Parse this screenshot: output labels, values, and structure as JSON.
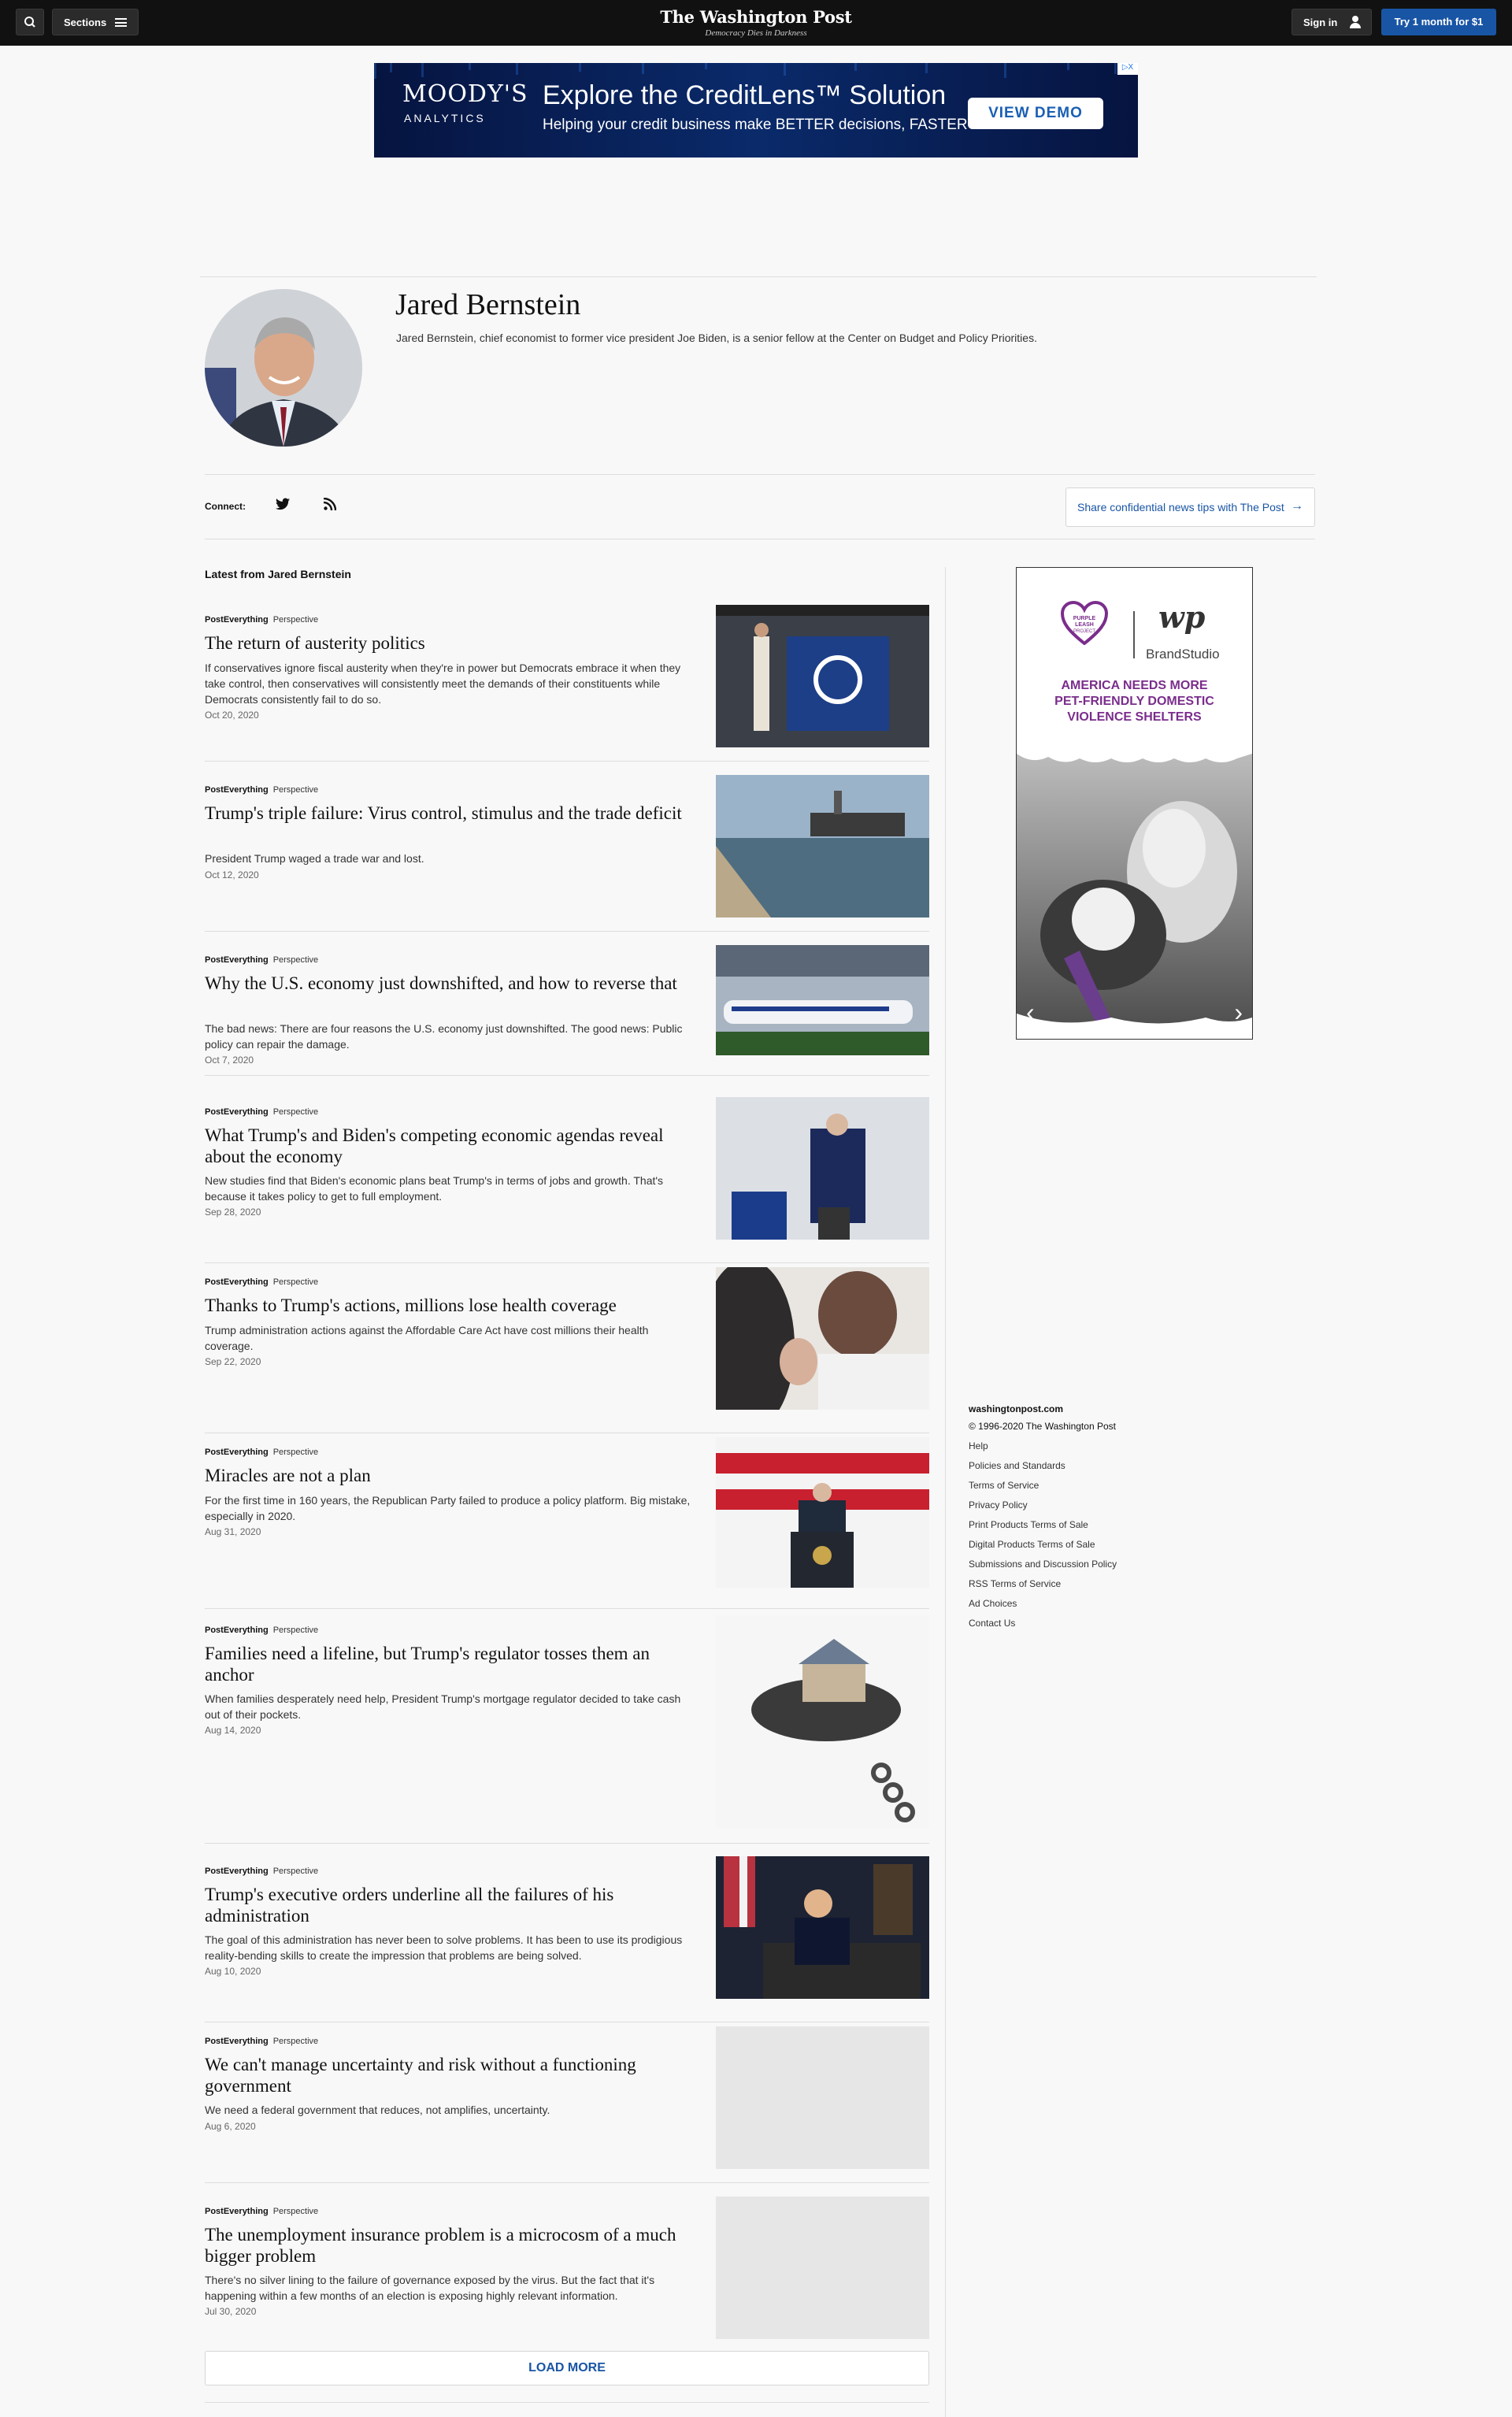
{
  "nav": {
    "search_icon": "search-icon",
    "sections_label": "Sections",
    "logo": "The Washington Post",
    "tagline": "Democracy Dies in Darkness",
    "signin_label": "Sign in",
    "subscribe_label": "Try 1 month for $1"
  },
  "banner_ad": {
    "brand": "MOODY'S",
    "brand_sub": "ANALYTICS",
    "headline": "Explore the CreditLens™ Solution",
    "subline": "Helping your credit business make BETTER decisions, FASTER",
    "cta": "VIEW DEMO",
    "close": "▷X"
  },
  "author": {
    "name": "Jared Bernstein",
    "bio": "Jared Bernstein, chief economist to former vice president Joe Biden, is a senior fellow at the Center on Budget and Policy Priorities."
  },
  "connect": {
    "label": "Connect:",
    "tips_label": "Share confidential news tips with The Post",
    "tips_arrow": "→"
  },
  "latest": {
    "title": "Latest from Jared Bernstein",
    "articles": [
      {
        "section": "PostEverything",
        "type": "Perspective",
        "headline": "The return of austerity politics",
        "blurb": "If conservatives ignore fiscal austerity when they're in power but Democrats embrace it when they take control, then conservatives will consistently meet the demands of their constituents while Democrats consistently fail to do so.",
        "date": "Oct 20, 2020"
      },
      {
        "section": "PostEverything",
        "type": "Perspective",
        "headline": "Trump's triple failure: Virus control, stimulus and the trade deficit",
        "blurb": "President Trump waged a trade war and lost.",
        "date": "Oct 12, 2020"
      },
      {
        "section": "PostEverything",
        "type": "Perspective",
        "headline": "Why the U.S. economy just downshifted, and how to reverse that",
        "blurb": "The bad news: There are four reasons the U.S. economy just downshifted. The good news: Public policy can repair the damage.",
        "date": "Oct 7, 2020"
      },
      {
        "section": "PostEverything",
        "type": "Perspective",
        "headline": "What Trump's and Biden's competing economic agendas reveal about the economy",
        "blurb": "New studies find that Biden's economic plans beat Trump's in terms of jobs and growth. That's because it takes policy to get to full employment.",
        "date": "Sep 28, 2020"
      },
      {
        "section": "PostEverything",
        "type": "Perspective",
        "headline": "Thanks to Trump's actions, millions lose health coverage",
        "blurb": "Trump administration actions against the Affordable Care Act have cost millions their health coverage.",
        "date": "Sep 22, 2020"
      },
      {
        "section": "PostEverything",
        "type": "Perspective",
        "headline": "Miracles are not a plan",
        "blurb": "For the first time in 160 years, the Republican Party failed to produce a policy platform. Big mistake, especially in 2020.",
        "date": "Aug 31, 2020"
      },
      {
        "section": "PostEverything",
        "type": "Perspective",
        "headline": "Families need a lifeline, but Trump's regulator tosses them an anchor",
        "blurb": "When families desperately need help, President Trump's mortgage regulator decided to take cash out of their pockets.",
        "date": "Aug 14, 2020"
      },
      {
        "section": "PostEverything",
        "type": "Perspective",
        "headline": "Trump's executive orders underline all the failures of his administration",
        "blurb": "The goal of this administration has never been to solve problems. It has been to use its prodigious reality-bending skills to create the impression that problems are being solved.",
        "date": "Aug 10, 2020"
      },
      {
        "section": "PostEverything",
        "type": "Perspective",
        "headline": "We can't manage uncertainty and risk without a functioning government",
        "blurb": "We need a federal government that reduces, not amplifies, uncertainty.",
        "date": "Aug 6, 2020"
      },
      {
        "section": "PostEverything",
        "type": "Perspective",
        "headline": "The unemployment insurance problem is a microcosm of a much bigger problem",
        "blurb": "There's no silver lining to the failure of governance exposed by the virus. But the fact that it's happening within a few months of an election is exposing highly relevant information.",
        "date": "Jul 30, 2020"
      }
    ],
    "load_more": "LOAD MORE"
  },
  "side_ad": {
    "partner": "PURPLE LEASH PROJECT",
    "wp_mark": "wp",
    "studio": "BrandStudio",
    "line1": "AMERICA NEEDS MORE",
    "line2": "PET-FRIENDLY DOMESTIC",
    "line3": "VIOLENCE SHELTERS",
    "prev": "‹",
    "next": "›"
  },
  "footer": {
    "site": "washingtonpost.com",
    "copyright": "© 1996-2020 The Washington Post",
    "links": [
      "Help",
      "Policies and Standards",
      "Terms of Service",
      "Privacy Policy",
      "Print Products Terms of Sale",
      "Digital Products Terms of Sale",
      "Submissions and Discussion Policy",
      "RSS Terms of Service",
      "Ad Choices",
      "Contact Us"
    ]
  },
  "colors": {
    "accent": "#1955a5",
    "nav_bg": "#111111",
    "ad_purple": "#7a2d8c"
  }
}
